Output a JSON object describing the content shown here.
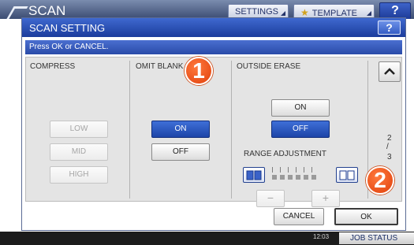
{
  "appbar": {
    "title": "SCAN",
    "settings_label": "SETTINGS",
    "template_label": "TEMPLATE",
    "help_label": "?"
  },
  "dialog": {
    "title": "SCAN SETTING",
    "help_label": "?",
    "message": "Press OK or CANCEL."
  },
  "compress": {
    "label": "COMPRESS",
    "low": "LOW",
    "mid": "MID",
    "high": "HIGH"
  },
  "omit_blank": {
    "label": "OMIT BLANK",
    "on": "ON",
    "off": "OFF",
    "selected": "ON"
  },
  "outside_erase": {
    "label": "OUTSIDE ERASE",
    "on": "ON",
    "off": "OFF",
    "selected": "OFF",
    "range_label": "RANGE ADJUSTMENT",
    "minus": "−",
    "plus": "+"
  },
  "pager": {
    "current": "2",
    "separator": "/",
    "total": "3"
  },
  "footer": {
    "cancel_label": "CANCEL",
    "ok_label": "OK"
  },
  "statusbar": {
    "time": "12:03",
    "job_status_label": "JOB STATUS"
  },
  "callouts": {
    "step1": "1",
    "step2": "2"
  },
  "colors": {
    "header_blue": "#2a4ba9",
    "selected_blue": "#1d45a8",
    "callout_orange": "#e0400c"
  }
}
